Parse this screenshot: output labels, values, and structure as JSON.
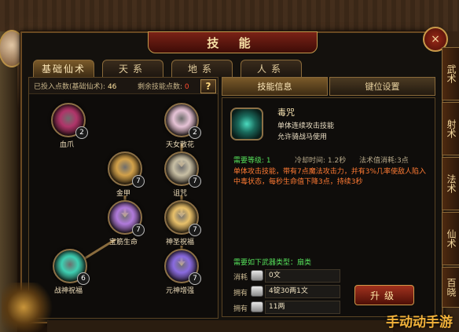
{
  "window": {
    "title": "技 能",
    "close_label": "×"
  },
  "tabs": [
    {
      "label": "基础仙术",
      "active": true
    },
    {
      "label": "天系",
      "active": false
    },
    {
      "label": "地系",
      "active": false
    },
    {
      "label": "人系",
      "active": false
    }
  ],
  "points": {
    "used_label": "已投入点数(",
    "used_tab": "基础仙术",
    "used_suffix": "):",
    "used_value": "46",
    "remaining_label": "剩余技能点数:",
    "remaining_value": "0",
    "help_label": "?"
  },
  "skills": [
    {
      "name": "血爪",
      "level": "2",
      "color": "#b0356a"
    },
    {
      "name": "天女散花",
      "level": "2",
      "color": "#e6c3d6"
    },
    {
      "name": "金甲",
      "level": "7",
      "color": "#d2a14a"
    },
    {
      "name": "诅咒",
      "level": "7",
      "color": "#c8bfa4"
    },
    {
      "name": "宝筋生命",
      "level": "7",
      "color": "#b07adb"
    },
    {
      "name": "神圣祝福",
      "level": "7",
      "color": "#e8c06a"
    },
    {
      "name": "战神祝福",
      "level": "6",
      "color": "#3ecfb2"
    },
    {
      "name": "元神增强",
      "level": "7",
      "color": "#8a6be0"
    }
  ],
  "detail_tabs": [
    {
      "label": "技能信息",
      "active": true
    },
    {
      "label": "键位设置",
      "active": false
    }
  ],
  "detail": {
    "name": "毒咒",
    "desc1": "单体连续攻击技能",
    "desc2": "允许骑战马使用",
    "req_level_label": "需要等级:",
    "req_level_value": "1",
    "cooldown_label": "冷却时间:",
    "cooldown_value": "1.2秒",
    "mana_label": "法术值消耗:",
    "mana_value": "3点",
    "effect": "单体攻击技能，带有7点魔法攻击力，并有3%几率使敌人陷入中毒状态，每秒生命值下降3点，持续3秒",
    "weapon_req": "需要如下武器类型：扇类",
    "costs": [
      {
        "label": "消耗",
        "value": "0文"
      },
      {
        "label": "拥有",
        "value": "4锭30两1文"
      },
      {
        "label": "拥有",
        "value": "11两"
      }
    ],
    "upgrade_label": "升级"
  },
  "side_tabs": [
    "武术",
    "射术",
    "法术",
    "仙术",
    "百晓"
  ],
  "watermark": "手动动手游"
}
